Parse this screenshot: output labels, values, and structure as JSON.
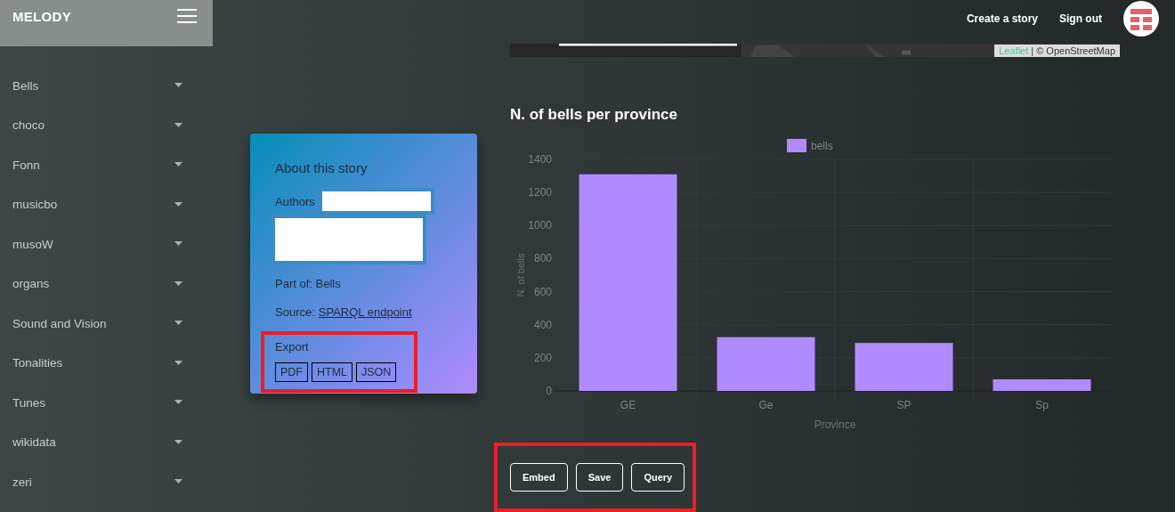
{
  "brand": {
    "title": "MELODY"
  },
  "nav": [
    {
      "label": "Create a story"
    },
    {
      "label": "Sign out"
    }
  ],
  "sidebar": {
    "items": [
      {
        "label": "Bells",
        "expanded": false
      },
      {
        "label": "choco",
        "expanded": false
      },
      {
        "label": "Fonn",
        "expanded": false
      },
      {
        "label": "musicbo",
        "expanded": false
      },
      {
        "label": "musoW",
        "expanded": false
      },
      {
        "label": "organs",
        "expanded": false
      },
      {
        "label": "Sound and Vision",
        "expanded": false
      },
      {
        "label": "Tonalities",
        "expanded": false
      },
      {
        "label": "Tunes",
        "expanded": false
      },
      {
        "label": "wikidata",
        "expanded": false
      },
      {
        "label": "zeri",
        "expanded": false
      }
    ]
  },
  "map": {
    "kind": "picture",
    "attribution": {
      "link": "Leaflet",
      "text": "| © OpenStreetMap"
    }
  },
  "story_card": {
    "title": "About this story",
    "authors": {
      "label": "Authors",
      "redacted": true
    },
    "part_of": "Part of: Bells",
    "source": {
      "label": "Source:",
      "link": "SPARQL endpoint"
    },
    "export": {
      "label": "Export",
      "highlighted": true,
      "buttons": [
        "PDF",
        "HTML",
        "JSON"
      ]
    }
  },
  "chart": {
    "title": "N. of bells per province",
    "chart_data": {
      "type": "bar",
      "xlabel": "Province",
      "ylabel": "N. of bells",
      "categories": [
        "GE",
        "Ge",
        "SP",
        "Sp"
      ],
      "series": [
        {
          "name": "bells",
          "color": "#b08bff",
          "values": [
            1310,
            325,
            290,
            70
          ]
        }
      ],
      "grid": true,
      "ylim": [
        0,
        1400
      ],
      "yticks": [
        0,
        200,
        400,
        600,
        800,
        1000,
        1200,
        1400
      ]
    }
  },
  "actions": {
    "highlighted": true,
    "buttons": [
      "Embed",
      "Save",
      "Query"
    ]
  }
}
